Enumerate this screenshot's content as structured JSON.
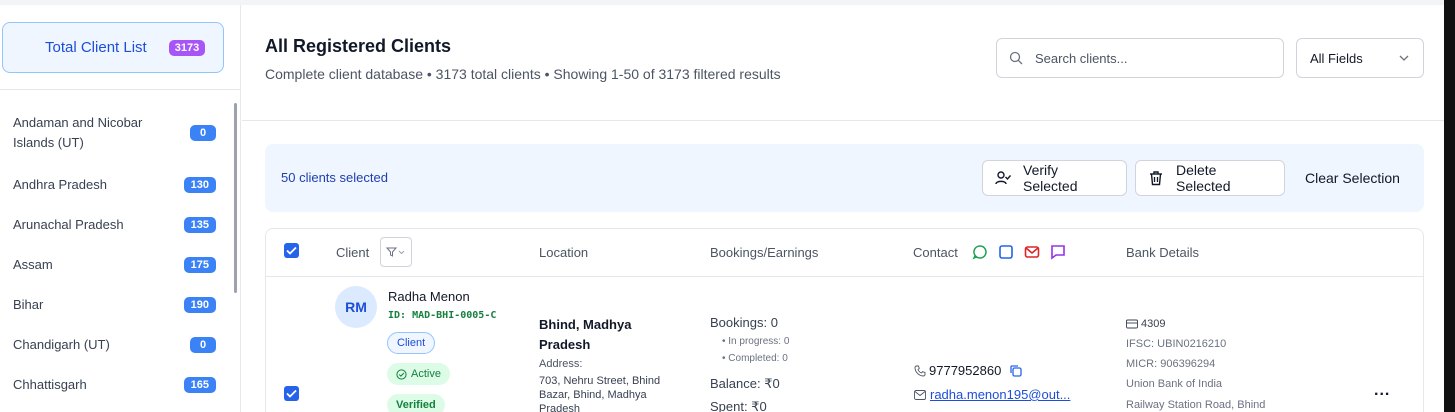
{
  "sidebar": {
    "total": {
      "label": "Total Client List",
      "count": "3173"
    },
    "states": [
      {
        "name": "Andaman and Nicobar Islands (UT)",
        "count": "0"
      },
      {
        "name": "Andhra Pradesh",
        "count": "130"
      },
      {
        "name": "Arunachal Pradesh",
        "count": "135"
      },
      {
        "name": "Assam",
        "count": "175"
      },
      {
        "name": "Bihar",
        "count": "190"
      },
      {
        "name": "Chandigarh (UT)",
        "count": "0"
      },
      {
        "name": "Chhattisgarh",
        "count": "165"
      }
    ]
  },
  "header": {
    "title": "All Registered Clients",
    "subtitle": "Complete client database • 3173 total clients • Showing 1-50 of 3173 filtered results",
    "search_placeholder": "Search clients...",
    "field_select": "All Fields"
  },
  "selection": {
    "count_text": "50 clients selected",
    "verify_label": "Verify Selected",
    "delete_label": "Delete Selected",
    "clear_label": "Clear Selection"
  },
  "table": {
    "columns": {
      "client": "Client",
      "location": "Location",
      "bookings": "Bookings/Earnings",
      "contact": "Contact",
      "bank": "Bank Details"
    },
    "rows": [
      {
        "initials": "RM",
        "name": "Radha Menon",
        "id": "ID: MAD-BHI-0005-C",
        "type": "Client",
        "status": "Active",
        "verified": "Verified",
        "location": "Bhind, Madhya Pradesh",
        "address_label": "Address:",
        "address": "703, Nehru Street, Bhind Bazar, Bhind, Madhya Pradesh",
        "bookings": "Bookings: 0",
        "in_progress": "• In progress: 0",
        "completed": "• Completed: 0",
        "balance": "Balance: ₹0",
        "spent": "Spent: ₹0",
        "phone": "9777952860",
        "email": "radha.menon195@out...",
        "account": "4309",
        "ifsc": "IFSC: UBIN0216210",
        "micr": "MICR: 906396294",
        "bank": "Union Bank of India",
        "branch": "Railway Station Road, Bhind",
        "more": "..."
      }
    ]
  },
  "colors": {
    "accent": "#2563eb",
    "badge_purple": "#a855f7",
    "badge_blue": "#3b82f6",
    "whatsapp": "#16a34a",
    "email": "#dc2626",
    "chat": "#9333ea"
  }
}
